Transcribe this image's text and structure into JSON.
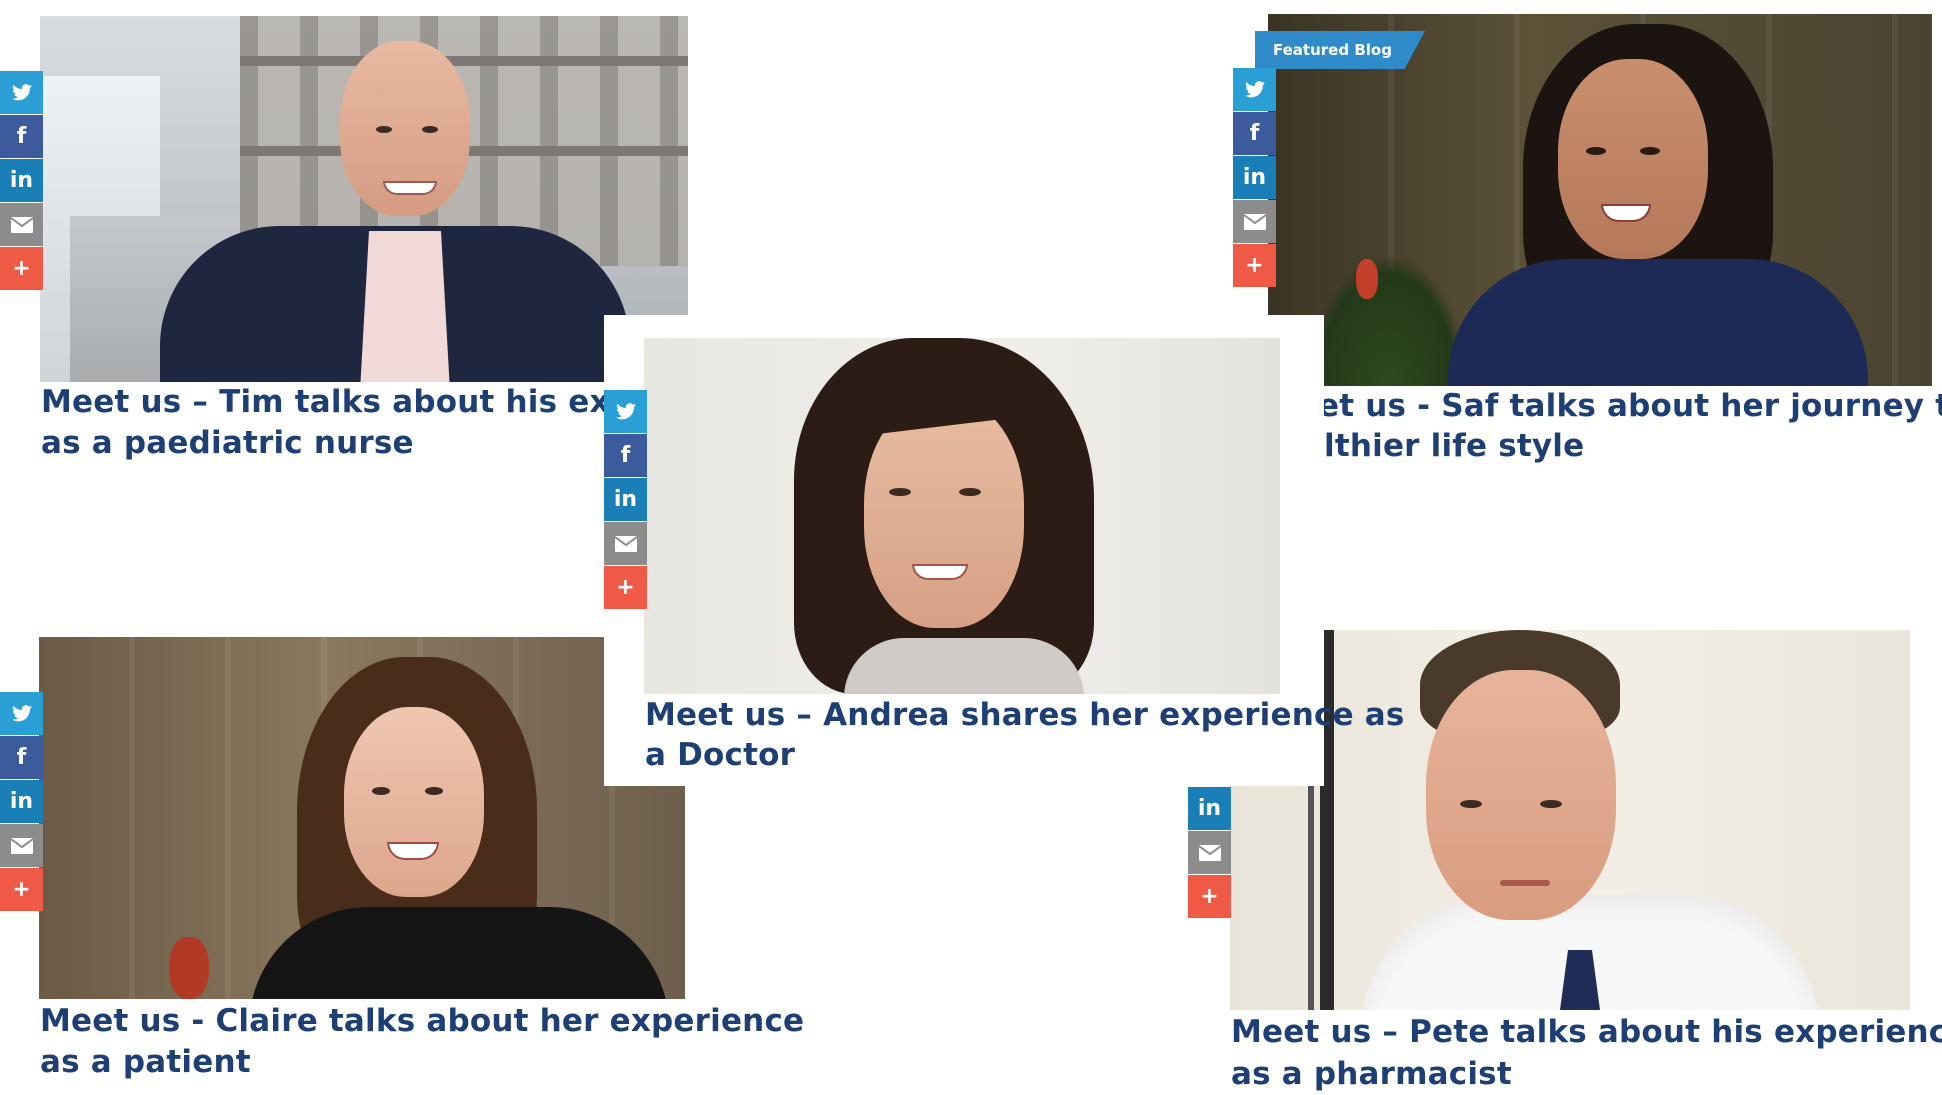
{
  "cards": [
    {
      "id": "tim",
      "title": "Meet us – Tim talks about his experience as a paediatric nurse",
      "line1": "Meet us – Tim talks about his experi",
      "line2": "as a paediatric nurse"
    },
    {
      "id": "saf",
      "title": "Meet us - Saf talks about her journey to a healthier life style",
      "line1": "et us - Saf talks about her journey to a",
      "line2": "lthier life style",
      "badge": "Featured Blog"
    },
    {
      "id": "andrea",
      "title": "Meet us – Andrea shares her experience as a Doctor",
      "line1": "Meet us – Andrea shares her experience as",
      "line2": "a Doctor"
    },
    {
      "id": "claire",
      "title": "Meet us - Claire talks about her experience as a patient",
      "line1": "Meet us - Claire talks about her experience",
      "line2": "as a patient"
    },
    {
      "id": "pete",
      "title": "Meet us – Pete talks about his experience as a pharmacist",
      "line1": "Meet us – Pete talks about his experience",
      "line2": "as a pharmacist"
    }
  ],
  "share_icons": [
    "twitter-icon",
    "facebook-icon",
    "linkedin-icon",
    "email-icon",
    "plus-icon"
  ],
  "share_labels": {
    "facebook": "f",
    "linkedin": "in",
    "plus": "+"
  },
  "colors": {
    "title": "#1e3f73",
    "twitter": "#2a9fd6",
    "facebook": "#3b5b9c",
    "linkedin": "#1b7fb7",
    "email": "#8c8c8c",
    "plus": "#ee5a45",
    "badge": "#2f8bc9"
  }
}
